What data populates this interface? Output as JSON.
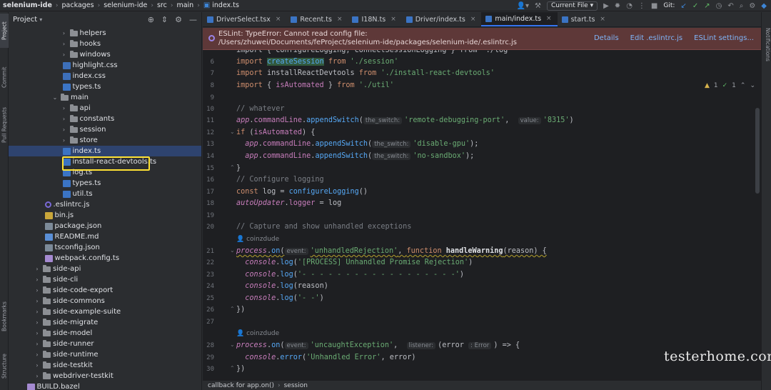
{
  "breadcrumb": [
    "selenium-ide",
    "packages",
    "selenium-ide",
    "src",
    "main",
    "index.ts"
  ],
  "toolbar": {
    "run_config_label": "Current File",
    "git_label": "Git:"
  },
  "left_tool_tabs": [
    "Project",
    "Commit",
    "Pull Requests",
    "Bookmarks",
    "Structure"
  ],
  "right_tool_tabs": [
    "Notifications"
  ],
  "project_panel": {
    "title": "Project",
    "tree": [
      {
        "label": "helpers",
        "type": "folder",
        "depth": 5,
        "expanded": false
      },
      {
        "label": "hooks",
        "type": "folder",
        "depth": 5,
        "expanded": false
      },
      {
        "label": "windows",
        "type": "folder",
        "depth": 5,
        "expanded": false
      },
      {
        "label": "highlight.css",
        "type": "css",
        "depth": 5
      },
      {
        "label": "index.css",
        "type": "css",
        "depth": 5
      },
      {
        "label": "types.ts",
        "type": "ts",
        "depth": 5
      },
      {
        "label": "main",
        "type": "folder",
        "depth": 4,
        "expanded": true
      },
      {
        "label": "api",
        "type": "folder",
        "depth": 5,
        "expanded": false
      },
      {
        "label": "constants",
        "type": "folder",
        "depth": 5,
        "expanded": false
      },
      {
        "label": "session",
        "type": "folder",
        "depth": 5,
        "expanded": false
      },
      {
        "label": "store",
        "type": "folder",
        "depth": 5,
        "expanded": false
      },
      {
        "label": "index.ts",
        "type": "ts",
        "depth": 5,
        "selected": true
      },
      {
        "label": "install-react-devtools.ts",
        "type": "ts",
        "depth": 5
      },
      {
        "label": "log.ts",
        "type": "ts",
        "depth": 5
      },
      {
        "label": "types.ts",
        "type": "ts",
        "depth": 5
      },
      {
        "label": "util.ts",
        "type": "ts",
        "depth": 5
      },
      {
        "label": ".eslintrc.js",
        "type": "eslint",
        "depth": 3
      },
      {
        "label": "bin.js",
        "type": "js",
        "depth": 3
      },
      {
        "label": "package.json",
        "type": "json",
        "depth": 3
      },
      {
        "label": "README.md",
        "type": "md",
        "depth": 3
      },
      {
        "label": "tsconfig.json",
        "type": "json",
        "depth": 3
      },
      {
        "label": "webpack.config.ts",
        "type": "cfg",
        "depth": 3
      },
      {
        "label": "side-api",
        "type": "folder",
        "depth": 2,
        "expanded": false
      },
      {
        "label": "side-cli",
        "type": "folder",
        "depth": 2,
        "expanded": false
      },
      {
        "label": "side-code-export",
        "type": "folder",
        "depth": 2,
        "expanded": false
      },
      {
        "label": "side-commons",
        "type": "folder",
        "depth": 2,
        "expanded": false
      },
      {
        "label": "side-example-suite",
        "type": "folder",
        "depth": 2,
        "expanded": false
      },
      {
        "label": "side-migrate",
        "type": "folder",
        "depth": 2,
        "expanded": false
      },
      {
        "label": "side-model",
        "type": "folder",
        "depth": 2,
        "expanded": false
      },
      {
        "label": "side-runner",
        "type": "folder",
        "depth": 2,
        "expanded": false
      },
      {
        "label": "side-runtime",
        "type": "folder",
        "depth": 2,
        "expanded": false
      },
      {
        "label": "side-testkit",
        "type": "folder",
        "depth": 2,
        "expanded": false
      },
      {
        "label": "webdriver-testkit",
        "type": "folder",
        "depth": 2,
        "expanded": false
      },
      {
        "label": "BUILD.bazel",
        "type": "cfg",
        "depth": 1
      }
    ]
  },
  "editor_tabs": [
    {
      "label": "DriverSelect.tsx",
      "active": false,
      "icon": "ts"
    },
    {
      "label": "Recent.ts",
      "active": false,
      "icon": "ts"
    },
    {
      "label": "I18N.ts",
      "active": false,
      "icon": "ts"
    },
    {
      "label": "Driver/index.ts",
      "active": false,
      "icon": "ts"
    },
    {
      "label": "main/index.ts",
      "active": true,
      "icon": "ts"
    },
    {
      "label": "start.ts",
      "active": false,
      "icon": "ts"
    }
  ],
  "eslint_banner": {
    "line1": "ESLint: TypeError: Cannot read config file:",
    "line2": "/Users/zhuwei/Documents/feProject/selenium-ide/packages/selenium-ide/.eslintrc.js",
    "links": [
      "Details",
      "Edit .eslintrc.js",
      "ESLint settings..."
    ]
  },
  "inspections": {
    "warnings": "1",
    "ok": "1"
  },
  "code": {
    "line5_partial": "import { configureLogging, connectSessionLogging } from './log'",
    "lines": [
      {
        "n": "6",
        "t": "import createSession from './session'"
      },
      {
        "n": "7",
        "t": "import installReactDevtools from './install-react-devtools'"
      },
      {
        "n": "8",
        "t": "import { isAutomated } from './util'"
      },
      {
        "n": "9",
        "t": ""
      },
      {
        "n": "10",
        "t": "// whatever"
      },
      {
        "n": "11",
        "t": "app.commandLine.appendSwitch('remote-debugging-port', '8315')"
      },
      {
        "n": "12",
        "t": "if (isAutomated) {"
      },
      {
        "n": "13",
        "t": "app.commandLine.appendSwitch('disable-gpu');"
      },
      {
        "n": "14",
        "t": "app.commandLine.appendSwitch('no-sandbox');"
      },
      {
        "n": "15",
        "t": "}"
      },
      {
        "n": "16",
        "t": "// Configure logging"
      },
      {
        "n": "17",
        "t": "const log = configureLogging()"
      },
      {
        "n": "18",
        "t": "autoUpdater.logger = log"
      },
      {
        "n": "19",
        "t": ""
      },
      {
        "n": "20",
        "t": "// Capture and show unhandled exceptions"
      },
      {
        "n": "21",
        "t": "process.on('unhandledRejection', function handleWarning(reason) {"
      },
      {
        "n": "22",
        "t": "console.log('[PROCESS] Unhandled Promise Rejection')"
      },
      {
        "n": "23",
        "t": "console.log('- - - - - - - - - - - - - - - - - -')"
      },
      {
        "n": "24",
        "t": "console.log(reason)"
      },
      {
        "n": "25",
        "t": "console.log('- -')"
      },
      {
        "n": "26",
        "t": "})"
      },
      {
        "n": "27",
        "t": ""
      },
      {
        "n": "28",
        "t": "process.on('uncaughtException', (error : Error) => {"
      },
      {
        "n": "29",
        "t": "console.error('Unhandled Error', error)"
      },
      {
        "n": "30",
        "t": "})"
      }
    ],
    "hints": {
      "the_switch": "the_switch:",
      "value": "value:",
      "event": "event:",
      "listener": "listener:",
      "error_type": ": Error"
    },
    "authors": [
      "coinzdude",
      "coinzdude"
    ]
  },
  "statusbar": {
    "crumbs": [
      "callback for app.on()",
      "session"
    ]
  },
  "watermark": "testerhome.com"
}
